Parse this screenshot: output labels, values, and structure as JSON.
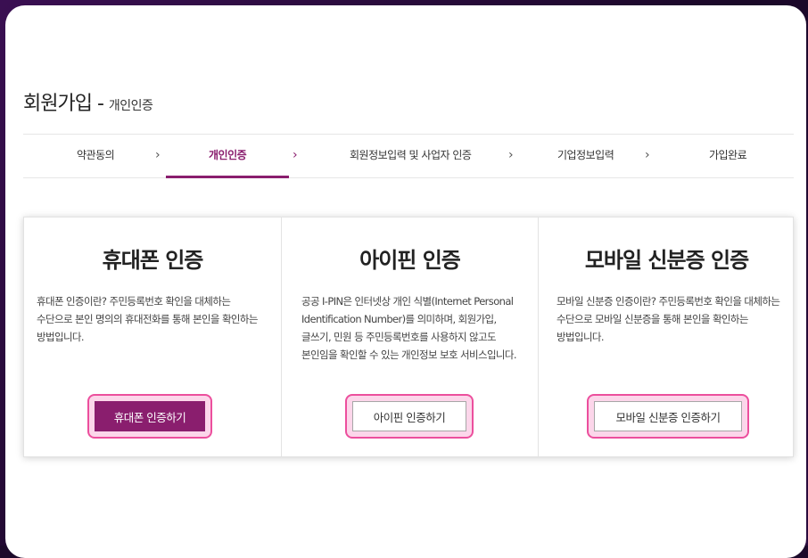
{
  "page": {
    "title": "회원가입 - ",
    "subtitle": "개인인증"
  },
  "steps": [
    {
      "label": "약관동의",
      "active": false
    },
    {
      "label": "개인인증",
      "active": true
    },
    {
      "label": "회원정보입력 및 사업자 인증",
      "active": false
    },
    {
      "label": "기업정보입력",
      "active": false
    },
    {
      "label": "가입완료",
      "active": false
    }
  ],
  "step_separator": "›",
  "methods": [
    {
      "title": "휴대폰 인증",
      "description": "휴대폰 인증이란? 주민등록번호 확인을 대체하는 수단으로 본인 명의의 휴대전화를 통해 본인을 확인하는 방법입니다.",
      "button": "휴대폰 인증하기"
    },
    {
      "title": "아이핀 인증",
      "description": "공공 I-PIN은 인터넷상 개인 식별(Internet Personal Identification Number)를 의미하며, 회원가입, 글쓰기, 민원 등 주민등록번호를 사용하지 않고도 본인임을 확인할 수 있는 개인정보 보호 서비스입니다.",
      "button": "아이핀 인증하기"
    },
    {
      "title": "모바일 신분증 인증",
      "description": "모바일 신분증 인증이란? 주민등록번호 확인을 대체하는 수단으로 모바일 신분증을 통해 본인을 확인하는 방법입니다.",
      "button": "모바일 신분증 인증하기"
    }
  ],
  "colors": {
    "accent": "#8a1e6e",
    "highlight_border": "#ec4f9d",
    "highlight_fill": "#fcd6ea"
  }
}
